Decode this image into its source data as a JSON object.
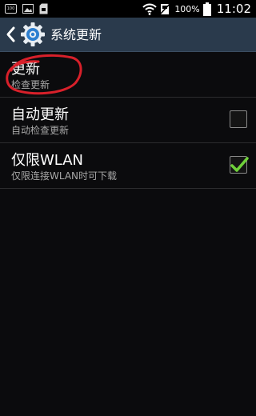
{
  "status_bar": {
    "notif_icons": [
      "calendar-icon",
      "image-icon",
      "sd-card-icon"
    ],
    "notif_text": "100",
    "battery_percent": "100%",
    "time": "11:02"
  },
  "header": {
    "title": "系统更新",
    "icon": "gear-icon",
    "back_icon": "chevron-left-icon"
  },
  "settings": [
    {
      "title": "更新",
      "subtitle": "检查更新",
      "has_checkbox": false
    },
    {
      "title": "自动更新",
      "subtitle": "自动检查更新",
      "has_checkbox": true,
      "checked": false
    },
    {
      "title": "仅限WLAN",
      "subtitle": "仅限连接WLAN时可下载",
      "has_checkbox": true,
      "checked": true
    }
  ],
  "colors": {
    "action_bar": "#2a3a4c",
    "check_mark": "#6fd13a",
    "annotation_circle": "#d8202a"
  }
}
